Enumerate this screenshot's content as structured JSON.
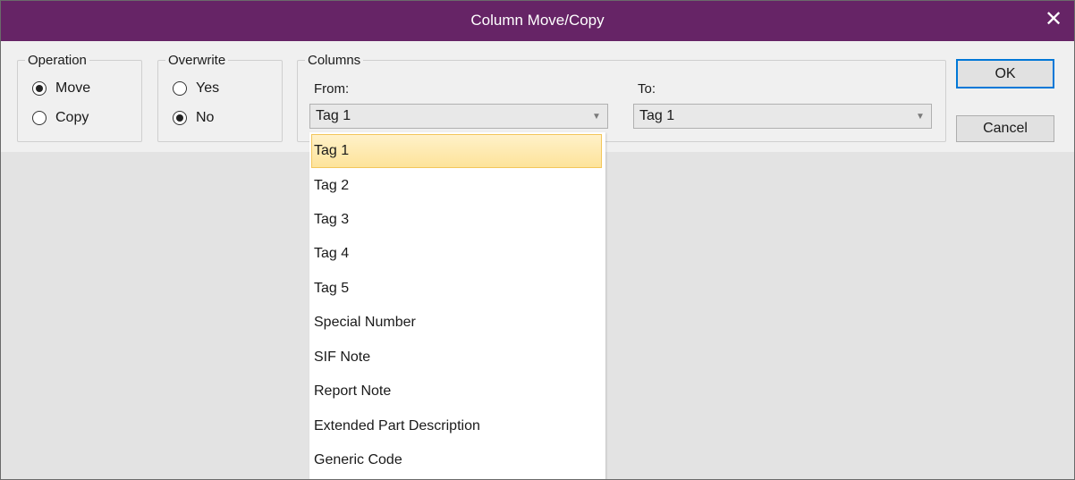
{
  "window": {
    "title": "Column Move/Copy",
    "close_glyph": "✕"
  },
  "operation": {
    "legend": "Operation",
    "options": [
      {
        "label": "Move",
        "checked": true
      },
      {
        "label": "Copy",
        "checked": false
      }
    ]
  },
  "overwrite": {
    "legend": "Overwrite",
    "options": [
      {
        "label": "Yes",
        "checked": false
      },
      {
        "label": "No",
        "checked": true
      }
    ]
  },
  "columns": {
    "legend": "Columns",
    "from_label": "From:",
    "from_value": "Tag 1",
    "to_label": "To:",
    "to_value": "Tag 1"
  },
  "buttons": {
    "ok": "OK",
    "cancel": "Cancel"
  },
  "dropdown": {
    "selected_index": 0,
    "items": [
      "Tag 1",
      "Tag 2",
      "Tag 3",
      "Tag 4",
      "Tag 5",
      "Special Number",
      "SIF Note",
      "Report Note",
      "Extended Part Description",
      "Generic Code"
    ]
  },
  "icons": {
    "combo_arrow": "chevron-down-icon",
    "close": "close-icon"
  },
  "colors": {
    "titlebar": "#662466",
    "selection": "#fde39a",
    "default_button_border": "#0078d7"
  }
}
